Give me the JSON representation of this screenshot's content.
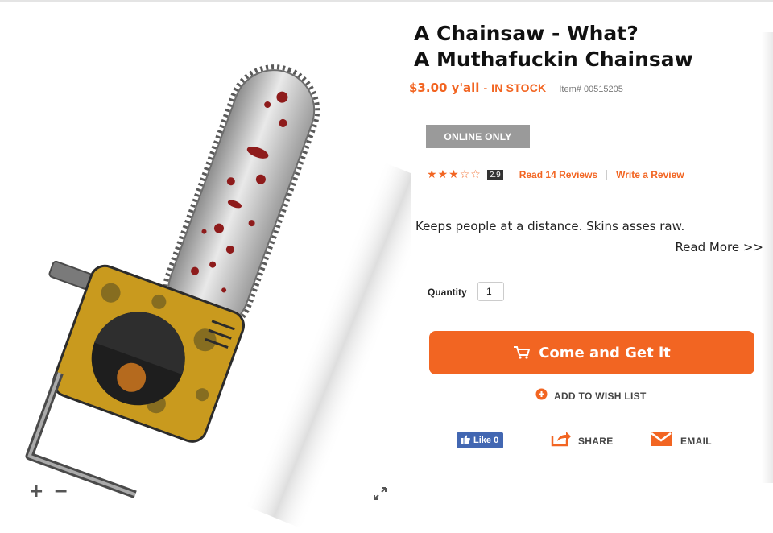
{
  "product": {
    "title_line1": "A Chainsaw - What?",
    "title_line2": "A Muthafuckin Chainsaw",
    "price": "$3.00 y'all",
    "price_separator": "-",
    "stock_status": "IN STOCK",
    "item_number": "Item# 00515205",
    "badge": "ONLINE ONLY",
    "description": "Keeps people at a distance. Skins asses raw.",
    "read_more": "Read More >>"
  },
  "rating": {
    "stars": 3,
    "max_stars": 5,
    "score": "2.9",
    "read_reviews": "Read 14 Reviews",
    "write_review": "Write a Review"
  },
  "purchase": {
    "quantity_label": "Quantity",
    "quantity_value": "1",
    "cta_label": "Come and Get it",
    "wishlist_label": "ADD TO WISH LIST"
  },
  "social": {
    "like_label": "Like 0",
    "share_label": "SHARE",
    "email_label": "EMAIL"
  },
  "image_controls": {
    "zoom_in": "+",
    "zoom_out": "−"
  },
  "colors": {
    "accent": "#f26522",
    "badge": "#9a9a9a",
    "facebook": "#4267b2"
  },
  "icons": {
    "cart": "cart-icon",
    "wishlist": "plus-circle-icon",
    "share": "share-icon",
    "email": "envelope-icon",
    "expand": "expand-icon",
    "like": "thumbs-up-icon"
  }
}
